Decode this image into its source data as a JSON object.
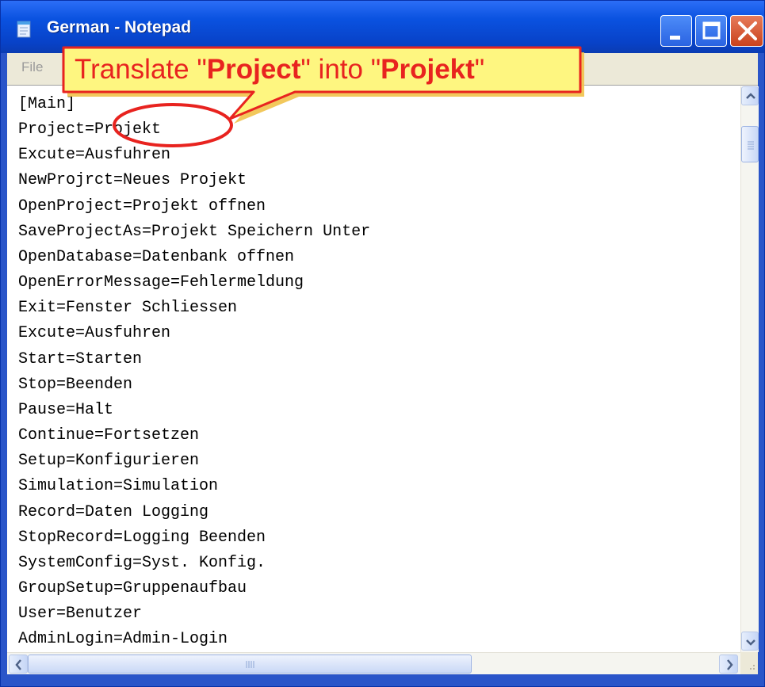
{
  "window": {
    "title": "German - Notepad",
    "accent_color": "#0a52e0",
    "close_color": "#c9421c"
  },
  "menu": {
    "file_label": "File"
  },
  "document": {
    "lines": [
      "[Main]",
      "Project=Projekt",
      "Excute=Ausfuhren",
      "NewProjrct=Neues Projekt",
      "OpenProject=Projekt offnen",
      "SaveProjectAs=Projekt Speichern Unter",
      "OpenDatabase=Datenbank offnen",
      "OpenErrorMessage=Fehlermeldung",
      "Exit=Fenster Schliessen",
      "Excute=Ausfuhren",
      "Start=Starten",
      "Stop=Beenden",
      "Pause=Halt",
      "Continue=Fortsetzen",
      "Setup=Konfigurieren",
      "Simulation=Simulation",
      "Record=Daten Logging",
      "StopRecord=Logging Beenden",
      "SystemConfig=Syst. Konfig.",
      "GroupSetup=Gruppenaufbau",
      "User=Benutzer",
      "AdminLogin=Admin-Login"
    ]
  },
  "callout": {
    "prefix": "Translate \"",
    "source_word": "Project",
    "middle": "\" into \"",
    "target_word": "Projekt",
    "suffix": "\"",
    "text_color": "#e8231f",
    "fill_color": "#fef680",
    "border_color": "#e8231f"
  }
}
